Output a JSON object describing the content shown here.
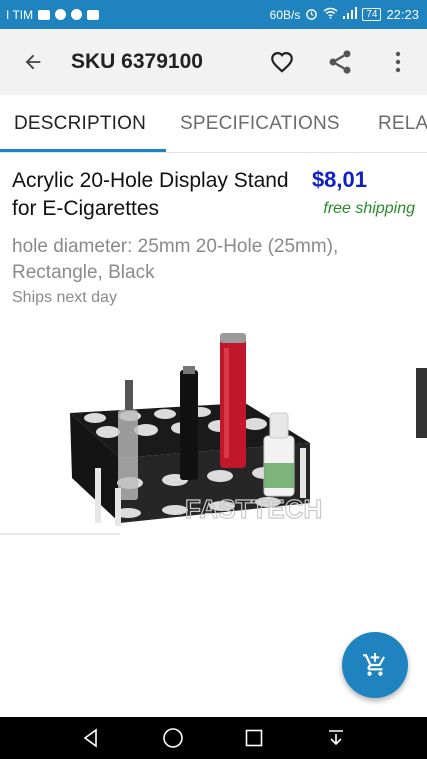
{
  "status_bar": {
    "carrier": "I TIM",
    "speed": "60B/s",
    "battery": "74",
    "time": "22:23"
  },
  "app_bar": {
    "title": "SKU 6379100",
    "back_icon": "arrow-back-icon",
    "favorite_icon": "heart-outline-icon",
    "share_icon": "share-icon",
    "more_icon": "more-vertical-icon"
  },
  "tabs": [
    {
      "label": "DESCRIPTION",
      "active": true
    },
    {
      "label": "SPECIFICATIONS",
      "active": false
    },
    {
      "label": "RELA",
      "active": false
    }
  ],
  "product": {
    "title": "Acrylic 20-Hole Display Stand for E-Cigarettes",
    "price": "$8,01",
    "shipping": "free shipping",
    "description": "hole diameter: 25mm 20-Hole (25mm), Rectangle, Black",
    "ships": "Ships next day",
    "image_watermark": "FASTTECH"
  },
  "fab": {
    "icon": "add-shopping-cart-icon"
  },
  "nav_bar": {
    "back_icon": "nav-back-icon",
    "home_icon": "nav-home-icon",
    "recents_icon": "nav-recents-icon",
    "notifications_icon": "nav-pulldown-icon"
  },
  "colors": {
    "primary": "#1f83bf",
    "price": "#1020c8",
    "shipping": "#2a8a2a"
  }
}
